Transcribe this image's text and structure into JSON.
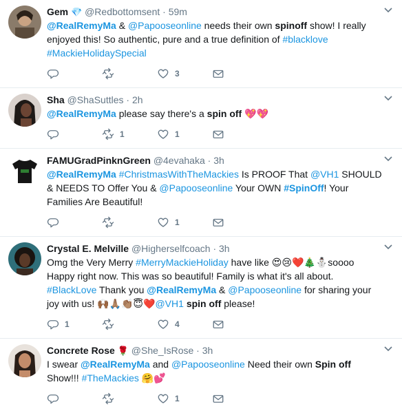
{
  "colors": {
    "link": "#1b95e0",
    "muted": "#657786",
    "text": "#14171a",
    "border": "#e6ecf0",
    "heart": "#e0245e"
  },
  "tweets": [
    {
      "name": "Gem",
      "name_emoji": "💎",
      "handle": "@Redbottomsent",
      "dot": "·",
      "time": "59m",
      "body": [
        {
          "t": "@RealRemyMa",
          "s": "mention-b"
        },
        {
          "t": " & ",
          "s": ""
        },
        {
          "t": "@Papooseonline",
          "s": "link"
        },
        {
          "t": " needs their own ",
          "s": ""
        },
        {
          "t": "spinoff",
          "s": "b"
        },
        {
          "t": " show!  I really enjoyed this!  So authentic, pure and a true definition of ",
          "s": ""
        },
        {
          "t": "#blacklove",
          "s": "link"
        },
        {
          "t": " ",
          "s": ""
        },
        {
          "t": "#MackieHolidaySpecial",
          "s": "link"
        }
      ],
      "reply_count": "",
      "retweet_count": "",
      "like_count": "3"
    },
    {
      "name": "Sha",
      "name_emoji": "",
      "handle": "@ShaSuttles",
      "dot": "·",
      "time": "2h",
      "body": [
        {
          "t": "@RealRemyMa",
          "s": "mention-b"
        },
        {
          "t": " please say there's a ",
          "s": ""
        },
        {
          "t": "spin off",
          "s": "b"
        },
        {
          "t": " 💖💖",
          "s": "emoji"
        }
      ],
      "reply_count": "",
      "retweet_count": "1",
      "like_count": "1"
    },
    {
      "name": "FAMUGradPinknGreen",
      "name_emoji": "",
      "handle": "@4evahaka",
      "dot": "·",
      "time": "3h",
      "body": [
        {
          "t": "@RealRemyMa",
          "s": "mention-b"
        },
        {
          "t": " ",
          "s": ""
        },
        {
          "t": "#ChristmasWithTheMackies",
          "s": "link"
        },
        {
          "t": " Is PROOF That ",
          "s": ""
        },
        {
          "t": "@VH1",
          "s": "link"
        },
        {
          "t": " SHOULD & NEEDS TO Offer You & ",
          "s": ""
        },
        {
          "t": "@Papooseonline",
          "s": "link"
        },
        {
          "t": " Your OWN ",
          "s": ""
        },
        {
          "t": "#SpinOff",
          "s": "mention-b"
        },
        {
          "t": "! Your Families Are Beautiful!",
          "s": ""
        }
      ],
      "reply_count": "",
      "retweet_count": "",
      "like_count": "1"
    },
    {
      "name": "Crystal E. Melville",
      "name_emoji": "",
      "handle": "@Higherselfcoach",
      "dot": "·",
      "time": "3h",
      "body": [
        {
          "t": "Omg the Very Merry ",
          "s": ""
        },
        {
          "t": "#MerryMackieHoliday",
          "s": "link"
        },
        {
          "t": " have like ",
          "s": ""
        },
        {
          "t": "😍😢❤️🎄⛄",
          "s": "emoji"
        },
        {
          "t": "soooo Happy right now. This was so beautiful! Family is what it's all about. ",
          "s": ""
        },
        {
          "t": "#BlackLove",
          "s": "link"
        },
        {
          "t": " Thank you ",
          "s": ""
        },
        {
          "t": "@RealRemyMa",
          "s": "mention-b"
        },
        {
          "t": "  & ",
          "s": ""
        },
        {
          "t": "@Papooseonline",
          "s": "link"
        },
        {
          "t": " for sharing your joy with us! ",
          "s": ""
        },
        {
          "t": "🙌🏾🙏🏽👏🏽😇❤️",
          "s": "emoji"
        },
        {
          "t": "@VH1",
          "s": "link"
        },
        {
          "t": " ",
          "s": ""
        },
        {
          "t": "spin off",
          "s": "b"
        },
        {
          "t": " please!",
          "s": ""
        }
      ],
      "reply_count": "1",
      "retweet_count": "",
      "like_count": "4"
    },
    {
      "name": "Concrete Rose",
      "name_emoji": "🌹",
      "handle": "@She_IsRose",
      "dot": "·",
      "time": "3h",
      "body": [
        {
          "t": "I swear ",
          "s": ""
        },
        {
          "t": "@RealRemyMa",
          "s": "mention-b"
        },
        {
          "t": "  and ",
          "s": ""
        },
        {
          "t": "@Papooseonline",
          "s": "link"
        },
        {
          "t": " Need their own ",
          "s": ""
        },
        {
          "t": "Spin off",
          "s": "b"
        },
        {
          "t": " Show!!! ",
          "s": ""
        },
        {
          "t": "#TheMackies",
          "s": "link"
        },
        {
          "t": " 🤗💕",
          "s": "emoji"
        }
      ],
      "reply_count": "",
      "retweet_count": "",
      "like_count": "1"
    }
  ]
}
